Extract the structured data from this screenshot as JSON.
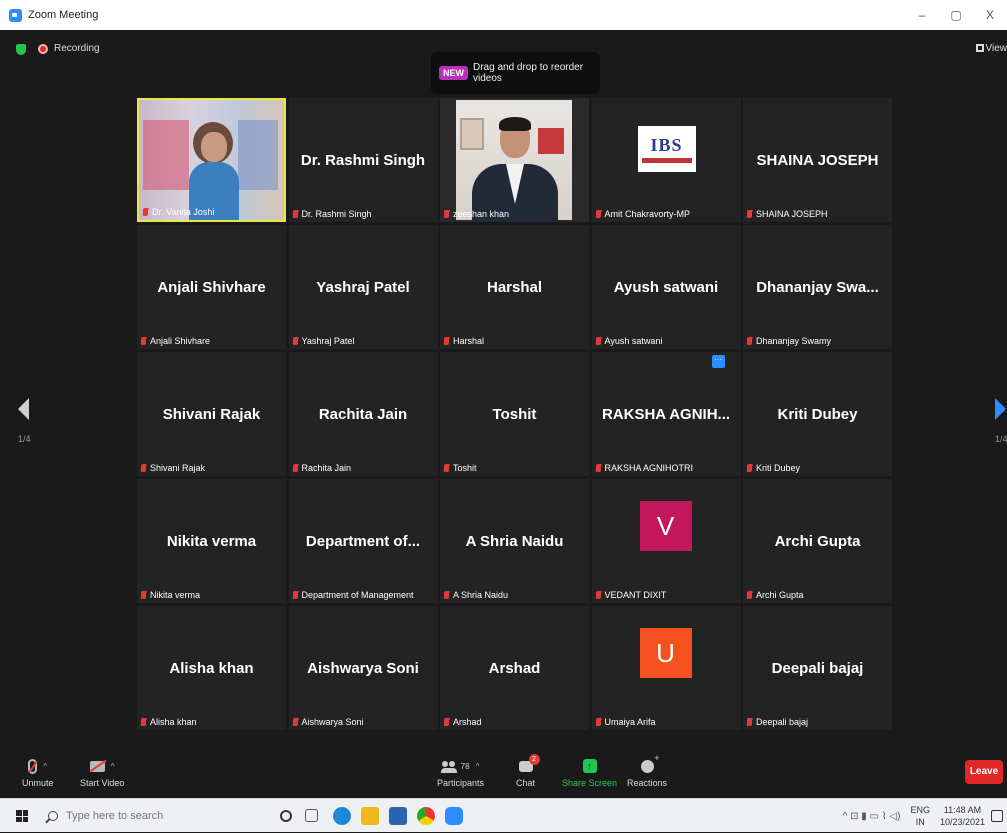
{
  "window": {
    "title": "Zoom Meeting",
    "minimize": "–",
    "restore": "▢",
    "close": "X"
  },
  "meeting_bar": {
    "recording_label": "Recording",
    "view_label": "View"
  },
  "banner": {
    "badge": "NEW",
    "text": "Drag and drop to reorder videos"
  },
  "pagination": {
    "left_page": "1/4",
    "right_page": "1/4"
  },
  "tiles": [
    {
      "big": "",
      "label": "Dr. Vanita Joshi",
      "type": "video-vanita",
      "active": true
    },
    {
      "big": "Dr. Rashmi Singh",
      "label": "Dr. Rashmi Singh",
      "type": "name"
    },
    {
      "big": "",
      "label": "zeeshan khan",
      "type": "video-zeeshan"
    },
    {
      "big": "",
      "label": "Amit Chakravorty-MP",
      "type": "logo",
      "logo_text": "IBS"
    },
    {
      "big": "SHAINA JOSEPH",
      "label": "SHAINA JOSEPH",
      "type": "name"
    },
    {
      "big": "Anjali Shivhare",
      "label": "Anjali Shivhare",
      "type": "name"
    },
    {
      "big": "Yashraj Patel",
      "label": "Yashraj Patel",
      "type": "name"
    },
    {
      "big": "Harshal",
      "label": "Harshal",
      "type": "name"
    },
    {
      "big": "Ayush satwani",
      "label": "Ayush satwani",
      "type": "name"
    },
    {
      "big": "Dhananjay  Swa...",
      "label": "Dhananjay Swamy",
      "type": "name"
    },
    {
      "big": "Shivani Rajak",
      "label": "Shivani Rajak",
      "type": "name"
    },
    {
      "big": "Rachita Jain",
      "label": "Rachita Jain",
      "type": "name"
    },
    {
      "big": "Toshit",
      "label": "Toshit",
      "type": "name"
    },
    {
      "big": "RAKSHA  AGNIH...",
      "label": "RAKSHA AGNIHOTRI",
      "type": "name",
      "more_badge": "···"
    },
    {
      "big": "Kriti Dubey",
      "label": "Kriti Dubey",
      "type": "name"
    },
    {
      "big": "Nikita verma",
      "label": "Nikita verma",
      "type": "name"
    },
    {
      "big": "Department  of...",
      "label": "Department of Management",
      "type": "name"
    },
    {
      "big": "A Shria Naidu",
      "label": "A Shria Naidu",
      "type": "name"
    },
    {
      "big": "",
      "label": "VEDANT DIXIT",
      "type": "avatar",
      "letter": "V",
      "color": "#c2185b"
    },
    {
      "big": "Archi Gupta",
      "label": "Archi Gupta",
      "type": "name"
    },
    {
      "big": "Alisha khan",
      "label": "Alisha khan",
      "type": "name"
    },
    {
      "big": "Aishwarya Soni",
      "label": "Aishwarya Soni",
      "type": "name"
    },
    {
      "big": "Arshad",
      "label": "Arshad",
      "type": "name"
    },
    {
      "big": "",
      "label": "Umaiya Arifa",
      "type": "avatar",
      "letter": "U",
      "color": "#f4511e"
    },
    {
      "big": "Deepali bajaj",
      "label": "Deepali bajaj",
      "type": "name"
    }
  ],
  "toolbar": {
    "unmute": "Unmute",
    "start_video": "Start Video",
    "participants": "Participants",
    "participants_count": "78",
    "chat": "Chat",
    "chat_badge": "2",
    "share_screen": "Share Screen",
    "reactions": "Reactions",
    "leave": "Leave"
  },
  "taskbar": {
    "search_placeholder": "Type here to search",
    "lang_top": "ENG",
    "lang_bottom": "IN",
    "time": "11:48 AM",
    "date": "10/23/2021",
    "tray_symbols": "^ ⊡ ▮ ▭ ⌇ ◁)"
  },
  "colors": {
    "accent": "#2d8cff",
    "leave": "#e02828",
    "share": "#23c552",
    "active_border": "#e6e64a"
  }
}
